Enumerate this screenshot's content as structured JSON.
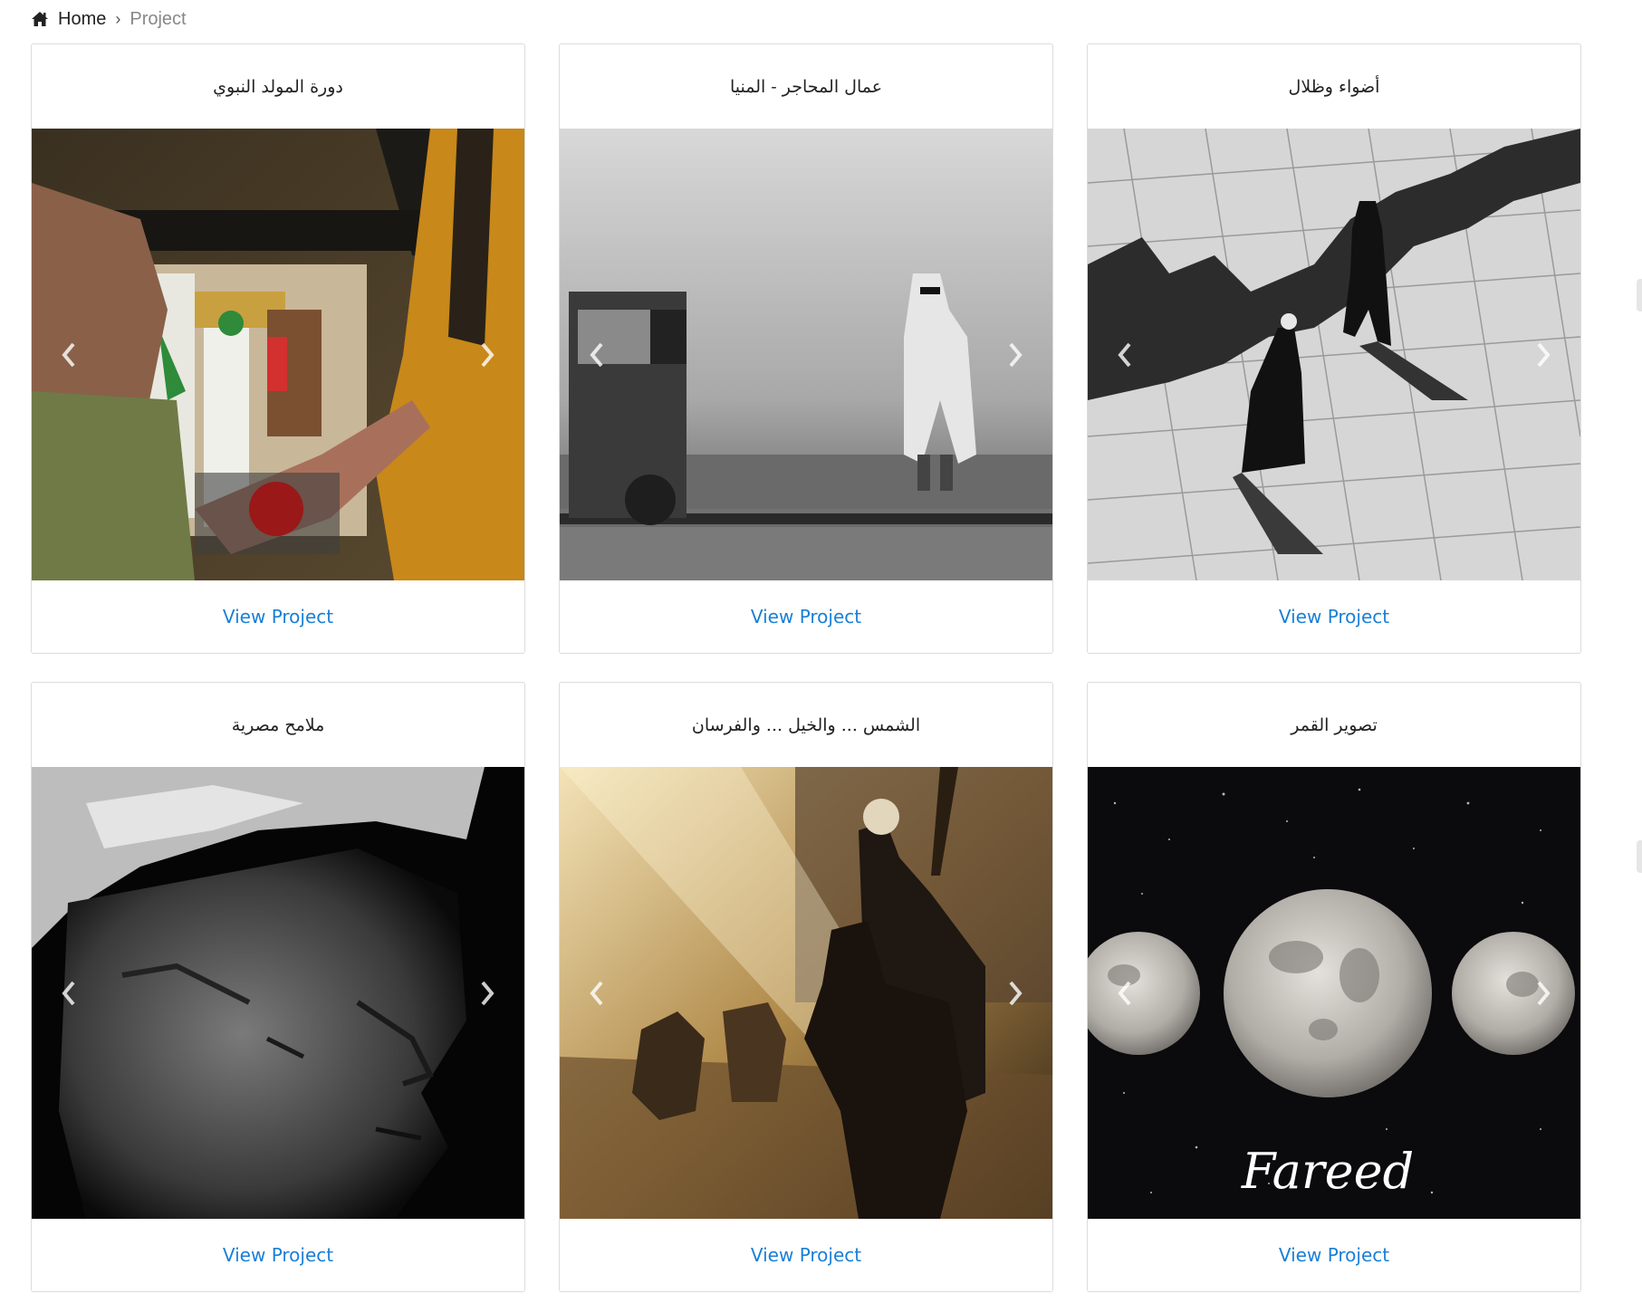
{
  "breadcrumb": {
    "icon": "home-icon",
    "home_label": "Home",
    "separator": "›",
    "current_label": "Project"
  },
  "projects": [
    {
      "title": "دورة المولد النبوي",
      "link_label": "View Project",
      "photo": "street-procession-color"
    },
    {
      "title": "عمال المحاجر - المنيا",
      "link_label": "View Project",
      "photo": "quarry-worker-mono"
    },
    {
      "title": "أضواء وظلال",
      "link_label": "View Project",
      "photo": "light-shadows-mono"
    },
    {
      "title": "ملامح مصرية",
      "link_label": "View Project",
      "photo": "old-man-portrait-mono"
    },
    {
      "title": "الشمس ... والخيل ... والفرسان",
      "link_label": "View Project",
      "photo": "horse-riders-golden"
    },
    {
      "title": "تصوير القمر",
      "link_label": "View Project",
      "photo": "moon-phases",
      "signature": "Fareed"
    }
  ],
  "carousel": {
    "prev_icon": "chevron-left-icon",
    "next_icon": "chevron-right-icon"
  },
  "colors": {
    "link": "#1a7fd6",
    "border": "#dcdcdc",
    "breadcrumb_current": "#888888"
  }
}
